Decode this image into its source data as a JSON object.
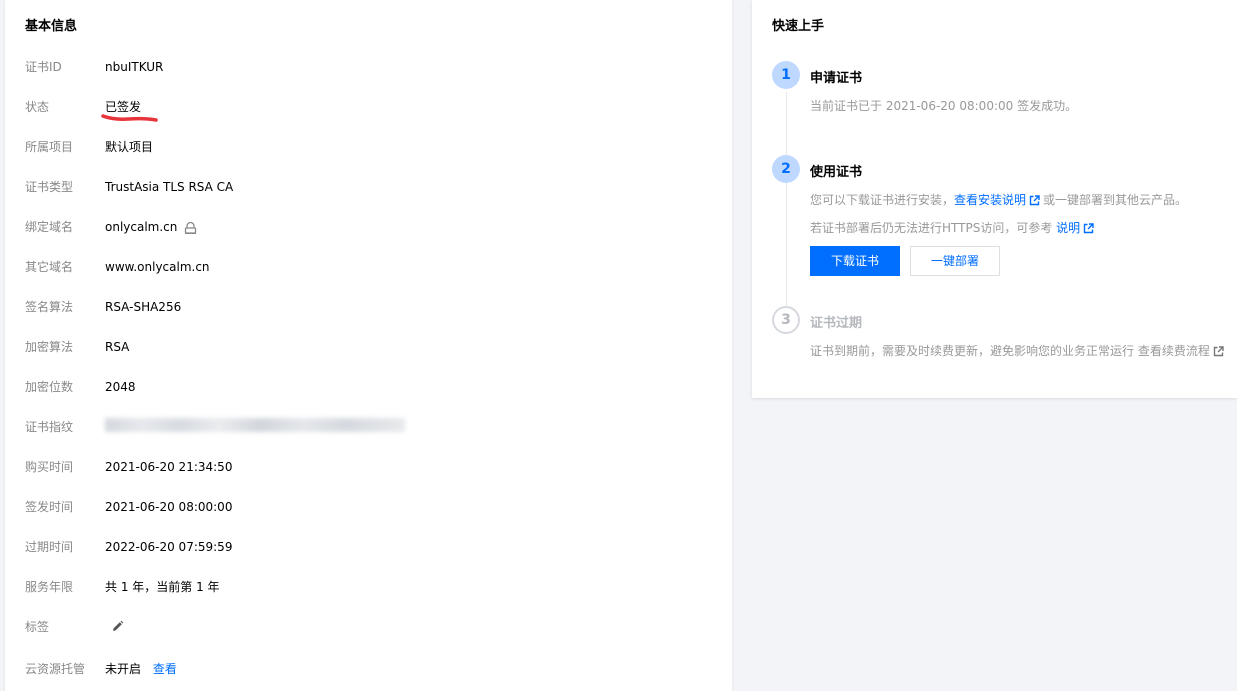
{
  "basic_info": {
    "title": "基本信息",
    "rows": [
      {
        "label": "证书ID",
        "value": "nbuITKUR"
      },
      {
        "label": "状态",
        "value": "已签发"
      },
      {
        "label": "所属项目",
        "value": "默认项目"
      },
      {
        "label": "证书类型",
        "value": "TrustAsia TLS RSA CA"
      },
      {
        "label": "绑定域名",
        "value": "onlycalm.cn"
      },
      {
        "label": "其它域名",
        "value": "www.onlycalm.cn"
      },
      {
        "label": "签名算法",
        "value": "RSA-SHA256"
      },
      {
        "label": "加密算法",
        "value": "RSA"
      },
      {
        "label": "加密位数",
        "value": "2048"
      },
      {
        "label": "证书指纹",
        "value": ""
      },
      {
        "label": "购买时间",
        "value": "2021-06-20 21:34:50"
      },
      {
        "label": "签发时间",
        "value": "2021-06-20 08:00:00"
      },
      {
        "label": "过期时间",
        "value": "2022-06-20 07:59:59"
      },
      {
        "label": "服务年限",
        "value": "共 1 年，当前第 1 年"
      },
      {
        "label": "标签",
        "value": ""
      },
      {
        "label": "云资源托管",
        "value": "未开启"
      }
    ],
    "hosting_link": "查看",
    "status_mark_color": "#e8343b"
  },
  "quick_start": {
    "title": "快速上手",
    "steps": [
      {
        "number": "1",
        "title": "申请证书",
        "desc": "当前证书已于 2021-06-20 08:00:00 签发成功。"
      },
      {
        "number": "2",
        "title": "使用证书",
        "desc_prefix": "您可以下载证书进行安装，",
        "desc_link": "查看安装说明",
        "desc_suffix": "或一键部署到其他云产品。",
        "desc2_prefix": "若证书部署后仍无法进行HTTPS访问，可参考",
        "desc2_link": "说明"
      },
      {
        "number": "3",
        "title": "证书过期",
        "desc": "证书到期前，需要及时续费更新，避免影响您的业务正常运行 查看续费流程"
      }
    ],
    "download_button": "下载证书",
    "deploy_button": "一键部署"
  },
  "colors": {
    "accent": "#006eff",
    "step_active_bg": "#bfd8ff",
    "label_gray": "#888888"
  }
}
